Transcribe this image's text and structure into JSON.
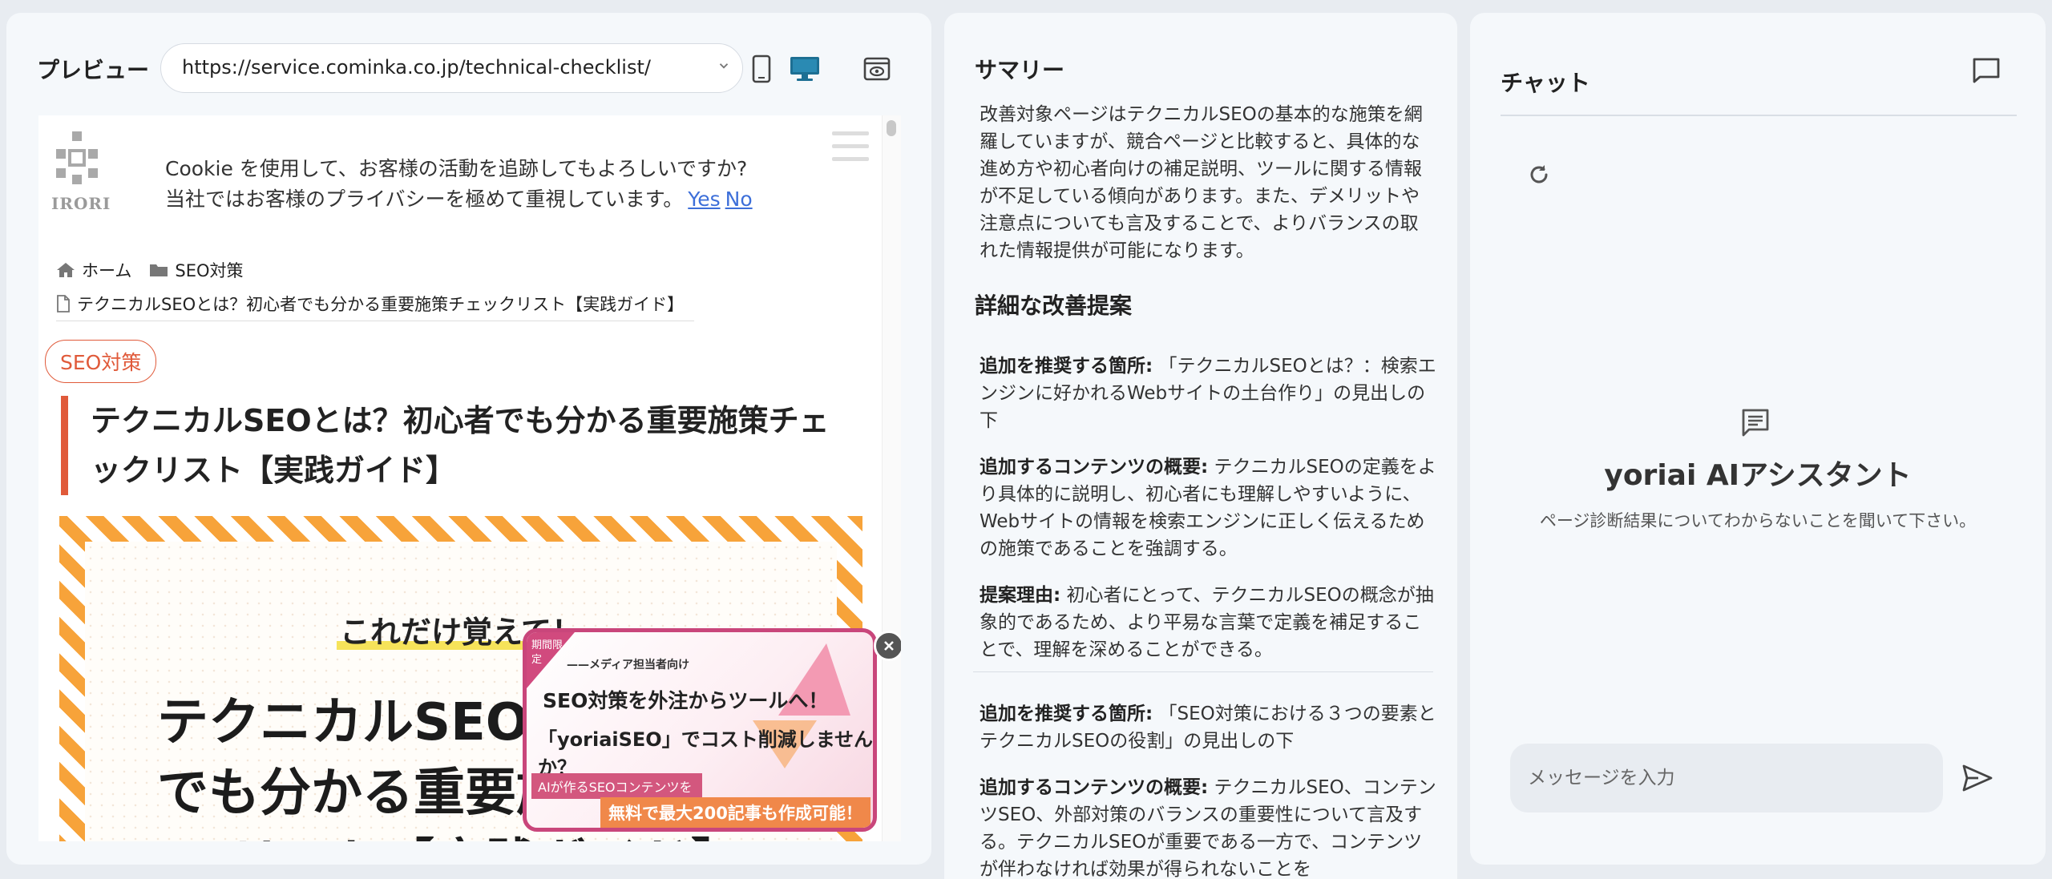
{
  "preview": {
    "title": "プレビュー",
    "url": "https://service.cominka.co.jp/technical-checklist/",
    "toolbar_icons": [
      "mobile-icon",
      "desktop-icon",
      "eye-icon"
    ],
    "site": {
      "logo_text": "IRORI",
      "cookie_line1": "Cookie を使用して、お客様の活動を追跡してもよろしいですか?",
      "cookie_line2": "当社ではお客様のプライバシーを極めて重視しています。",
      "cookie_yes": "Yes",
      "cookie_no": "No",
      "breadcrumb_home": "ホーム",
      "breadcrumb_category": "SEO対策",
      "breadcrumb_page": "テクニカルSEOとは？初心者でも分かる重要施策チェックリスト【実践ガイド】",
      "tag": "SEO対策",
      "article_title": "テクニカルSEOとは？初心者でも分かる重要施策チェックリスト【実践ガイド】",
      "eyecatch_sub": "これだけ覚えて！",
      "eyecatch_line1": "テクニカルSEOと",
      "eyecatch_line2": "でも分かる重要施",
      "eyecatch_line3": "リスト【実践ガイド】"
    },
    "popup": {
      "ribbon": "期間限定",
      "top": "——メディア担当者向け",
      "line1": "SEO対策を外注からツールへ！",
      "line2": "「yoriaiSEO」でコスト削減しませんか？",
      "line3": "AIが作るSEOコンテンツを",
      "line4": "無料で最大200記事も作成可能！",
      "close": "×"
    }
  },
  "summary": {
    "title": "サマリー",
    "body": "改善対象ページはテクニカルSEOの基本的な施策を網羅していますが、競合ページと比較すると、具体的な進め方や初心者向けの補足説明、ツールに関する情報が不足している傾向があります。また、デメリットや注意点についても言及することで、よりバランスの取れた情報提供が可能になります。",
    "detail_heading": "詳細な改善提案",
    "suggestions": [
      {
        "location_label": "追加を推奨する箇所:",
        "location": "「テクニカルSEOとは？：検索エンジンに好かれるWebサイトの土台作り」の見出しの下",
        "content_label": "追加するコンテンツの概要:",
        "content": "テクニカルSEOの定義をより具体的に説明し、初心者にも理解しやすいように、Webサイトの情報を検索エンジンに正しく伝えるための施策であることを強調する。",
        "reason_label": "提案理由:",
        "reason": "初心者にとって、テクニカルSEOの概念が抽象的であるため、より平易な言葉で定義を補足することで、理解を深めることができる。"
      },
      {
        "location_label": "追加を推奨する箇所:",
        "location": "「SEO対策における３つの要素とテクニカルSEOの役割」の見出しの下",
        "content_label": "追加するコンテンツの概要:",
        "content": "テクニカルSEO、コンテンツSEO、外部対策のバランスの重要性について言及する。テクニカルSEOが重要である一方で、コンテンツが伴わなければ効果が得られないことを"
      }
    ]
  },
  "chat": {
    "title": "チャット",
    "assistant_name": "yoriai AIアシスタント",
    "assistant_desc": "ページ診断結果についてわからないことを聞いて下さい。",
    "input_placeholder": "メッセージを入力"
  },
  "colors": {
    "accent": "#1d6f93",
    "tag": "#e05a3a",
    "link": "#3d6fd9",
    "popup_border": "#c9467b"
  }
}
